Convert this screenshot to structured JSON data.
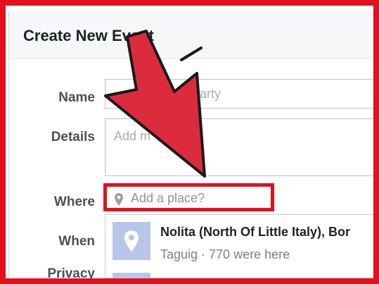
{
  "dialog": {
    "title": "Create New Event"
  },
  "form": {
    "name_label": "Name",
    "name_placeholder_visible": "arty",
    "details_label": "Details",
    "details_placeholder_visible": "Add m",
    "where_label": "Where",
    "where_placeholder": "Add a place?",
    "when_label": "When",
    "privacy_label": "Privacy"
  },
  "suggestion": {
    "place_name": "Nolita (North Of Little Italy), Bor",
    "place_meta": "Taguig · 770 were here"
  },
  "colors": {
    "highlight": "#e3101e",
    "arrow": "#dc2b3c",
    "topbar": "#3b4866"
  },
  "icons": {
    "where_field": "map-pin-icon",
    "suggestion": "map-pin-icon"
  }
}
